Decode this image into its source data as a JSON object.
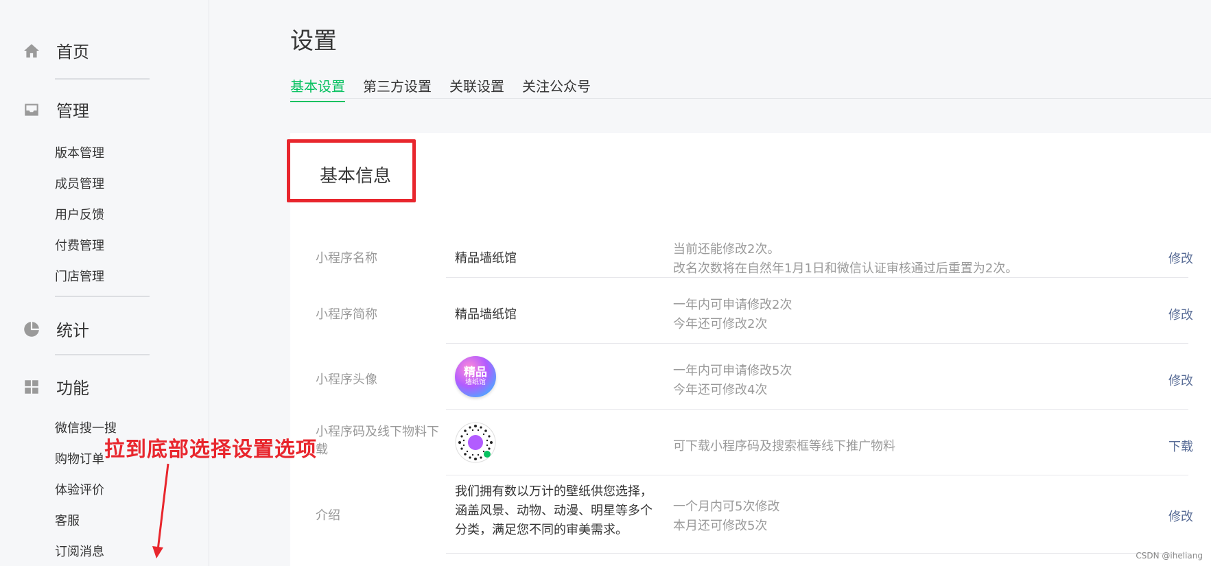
{
  "sidebar": {
    "home": {
      "label": "首页",
      "icon": "home-icon"
    },
    "manage": {
      "label": "管理",
      "icon": "inbox-icon",
      "items": [
        "版本管理",
        "成员管理",
        "用户反馈",
        "付费管理",
        "门店管理"
      ]
    },
    "stats": {
      "label": "统计",
      "icon": "pie-chart-icon"
    },
    "features": {
      "label": "功能",
      "icon": "grid-icon",
      "items": [
        "微信搜一搜",
        "购物订单",
        "体验评价",
        "客服",
        "订阅消息"
      ]
    }
  },
  "page": {
    "title": "设置",
    "tabs": [
      "基本设置",
      "第三方设置",
      "关联设置",
      "关注公众号"
    ],
    "active_tab": "基本设置"
  },
  "basic_info": {
    "title": "基本信息",
    "rows": [
      {
        "label": "小程序名称",
        "value": "精品墙纸馆",
        "tip1": "当前还能修改2次。",
        "tip2": "改名次数将在自然年1月1日和微信认证审核通过后重置为2次。",
        "action": "修改"
      },
      {
        "label": "小程序简称",
        "value": "精品墙纸馆",
        "tip1": "一年内可申请修改2次",
        "tip2": "今年还可修改2次",
        "action": "修改"
      },
      {
        "label": "小程序头像",
        "avatar_text1": "精品",
        "avatar_text2": "墙纸馆",
        "tip1": "一年内可申请修改5次",
        "tip2": "今年还可修改4次",
        "action": "修改"
      },
      {
        "label": "小程序码及线下物料下载",
        "tip1": "可下载小程序码及搜索框等线下推广物料",
        "action": "下载"
      },
      {
        "label": "介绍",
        "value_lines": [
          "我们拥有数以万计的壁纸供您选择，",
          "涵盖风景、动物、动漫、明星等多个",
          "分类，满足您不同的审美需求。"
        ],
        "tip1": "一个月内可5次修改",
        "tip2": "本月还可修改5次",
        "action": "修改"
      }
    ]
  },
  "annotation": {
    "text": "拉到底部选择设置选项",
    "color": "#e8262d"
  },
  "watermark": "CSDN @iheliang",
  "colors": {
    "accent_green": "#07c160",
    "link_blue": "#576b95",
    "annotation_red": "#e8262d"
  }
}
